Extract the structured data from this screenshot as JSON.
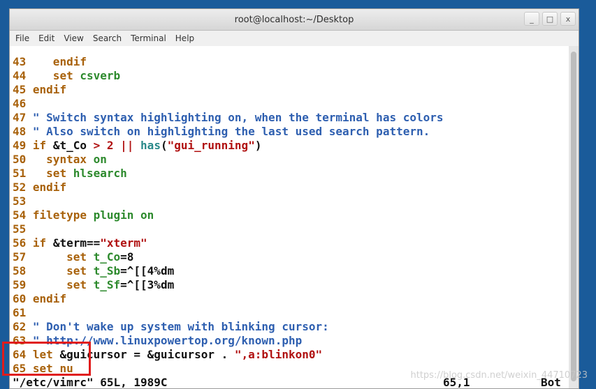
{
  "window": {
    "title": "root@localhost:~/Desktop",
    "controls": {
      "minimize": "_",
      "maximize": "□",
      "close": "x"
    }
  },
  "menu": [
    "File",
    "Edit",
    "View",
    "Search",
    "Terminal",
    "Help"
  ],
  "lines": [
    [
      {
        "t": "43 ",
        "c": "ln"
      },
      {
        "t": "   endif",
        "c": "kw"
      }
    ],
    [
      {
        "t": "44 ",
        "c": "ln"
      },
      {
        "t": "   set ",
        "c": "kw"
      },
      {
        "t": "csverb",
        "c": "tp"
      }
    ],
    [
      {
        "t": "45 ",
        "c": "ln"
      },
      {
        "t": "endif",
        "c": "kw"
      }
    ],
    [
      {
        "t": "46",
        "c": "ln"
      }
    ],
    [
      {
        "t": "47 ",
        "c": "ln"
      },
      {
        "t": "\" Switch syntax highlighting on, when the terminal has colors",
        "c": "cm"
      }
    ],
    [
      {
        "t": "48 ",
        "c": "ln"
      },
      {
        "t": "\" Also switch on highlighting the last used search pattern.",
        "c": "cm"
      }
    ],
    [
      {
        "t": "49 ",
        "c": "ln"
      },
      {
        "t": "if ",
        "c": "kw"
      },
      {
        "t": "&t_Co ",
        "c": ""
      },
      {
        "t": "> 2 || ",
        "c": "op"
      },
      {
        "t": "has",
        "c": "fn"
      },
      {
        "t": "(",
        "c": ""
      },
      {
        "t": "\"gui_running\"",
        "c": "st"
      },
      {
        "t": ")",
        "c": ""
      }
    ],
    [
      {
        "t": "50 ",
        "c": "ln"
      },
      {
        "t": "  syntax ",
        "c": "kw"
      },
      {
        "t": "on",
        "c": "tp"
      }
    ],
    [
      {
        "t": "51 ",
        "c": "ln"
      },
      {
        "t": "  set ",
        "c": "kw"
      },
      {
        "t": "hlsearch",
        "c": "tp"
      }
    ],
    [
      {
        "t": "52 ",
        "c": "ln"
      },
      {
        "t": "endif",
        "c": "kw"
      }
    ],
    [
      {
        "t": "53",
        "c": "ln"
      }
    ],
    [
      {
        "t": "54 ",
        "c": "ln"
      },
      {
        "t": "filetype ",
        "c": "kw"
      },
      {
        "t": "plugin on",
        "c": "tp"
      }
    ],
    [
      {
        "t": "55",
        "c": "ln"
      }
    ],
    [
      {
        "t": "56 ",
        "c": "ln"
      },
      {
        "t": "if ",
        "c": "kw"
      },
      {
        "t": "&term==",
        "c": ""
      },
      {
        "t": "\"xterm\"",
        "c": "st"
      }
    ],
    [
      {
        "t": "57 ",
        "c": "ln"
      },
      {
        "t": "     set ",
        "c": "kw"
      },
      {
        "t": "t_Co",
        "c": "tp"
      },
      {
        "t": "=8",
        "c": ""
      }
    ],
    [
      {
        "t": "58 ",
        "c": "ln"
      },
      {
        "t": "     set ",
        "c": "kw"
      },
      {
        "t": "t_Sb",
        "c": "tp"
      },
      {
        "t": "=^[[4%dm",
        "c": ""
      }
    ],
    [
      {
        "t": "59 ",
        "c": "ln"
      },
      {
        "t": "     set ",
        "c": "kw"
      },
      {
        "t": "t_Sf",
        "c": "tp"
      },
      {
        "t": "=^[[3%dm",
        "c": ""
      }
    ],
    [
      {
        "t": "60 ",
        "c": "ln"
      },
      {
        "t": "endif",
        "c": "kw"
      }
    ],
    [
      {
        "t": "61",
        "c": "ln"
      }
    ],
    [
      {
        "t": "62 ",
        "c": "ln"
      },
      {
        "t": "\" Don't wake up system with blinking cursor:",
        "c": "cm"
      }
    ],
    [
      {
        "t": "63 ",
        "c": "ln"
      },
      {
        "t": "\" http://www.linuxpowertop.org/known.php",
        "c": "cm"
      }
    ],
    [
      {
        "t": "64 ",
        "c": "ln"
      },
      {
        "t": "let ",
        "c": "kw"
      },
      {
        "t": "&guicursor = &guicursor . ",
        "c": ""
      },
      {
        "t": "\",a:blinkon0\"",
        "c": "st"
      }
    ],
    [
      {
        "t": "65 ",
        "c": "ln"
      },
      {
        "t": "set nu",
        "c": "kw"
      }
    ]
  ],
  "status": {
    "file": "\"/etc/vimrc\" 65L, 1989C",
    "position": "65,1",
    "scroll": "Bot"
  },
  "watermark": "https://blog.csdn.net/weixin_44710723"
}
